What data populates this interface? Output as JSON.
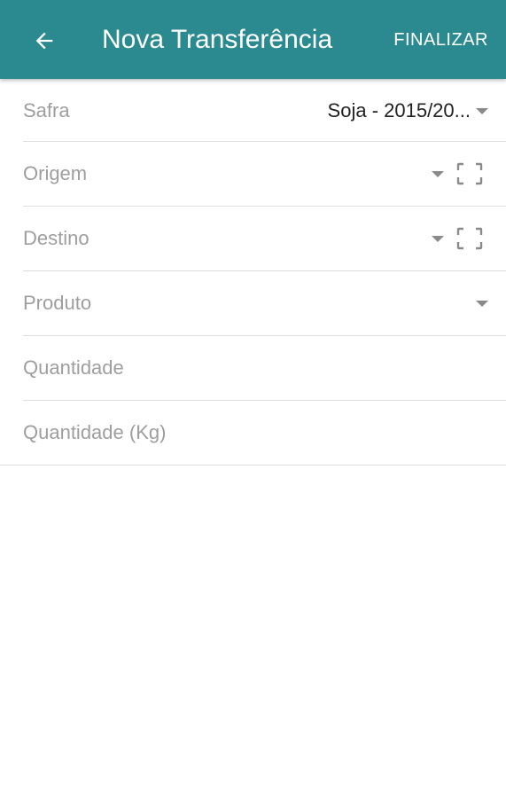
{
  "header": {
    "title": "Nova Transferência",
    "action_label": "FINALIZAR",
    "background_color": "#2a8a8f",
    "back_icon": "arrow-left-icon"
  },
  "form": {
    "safra": {
      "label": "Safra",
      "value": "Soja - 2015/20..."
    },
    "origem": {
      "label": "Origem"
    },
    "destino": {
      "label": "Destino"
    },
    "produto": {
      "label": "Produto"
    },
    "quantidade": {
      "label": "Quantidade"
    },
    "quantidade_kg": {
      "label": "Quantidade (Kg)"
    }
  }
}
